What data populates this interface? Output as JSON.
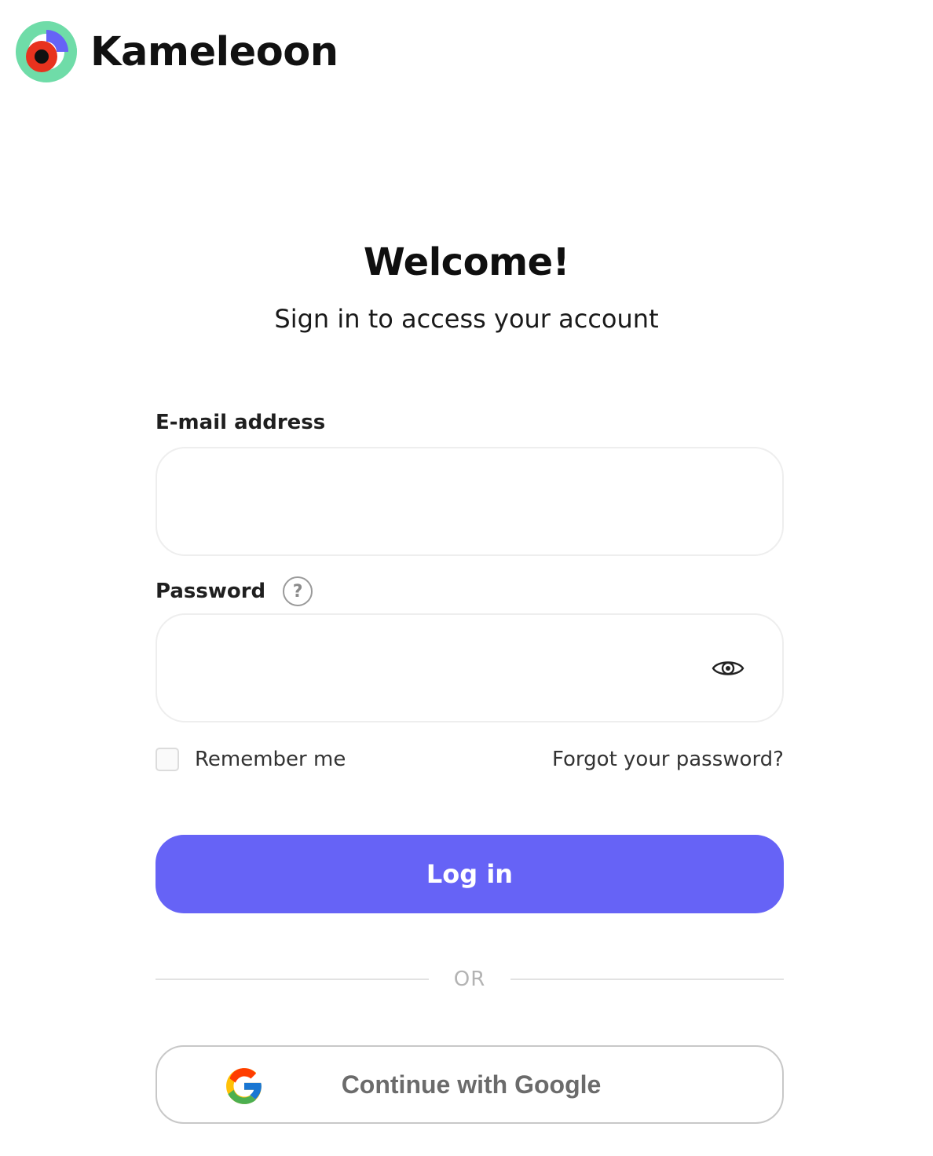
{
  "brand": {
    "name": "Kameleoon",
    "logo_icon": "kameleoon-logo-icon",
    "colors": {
      "mint": "#6fdca8",
      "purple": "#6663f6",
      "red": "#e8321e",
      "black": "#111111"
    }
  },
  "heading": {
    "title": "Welcome!",
    "subtitle": "Sign in to access your account"
  },
  "form": {
    "email": {
      "label": "E-mail address",
      "value": "",
      "placeholder": ""
    },
    "password": {
      "label": "Password",
      "value": "",
      "placeholder": "",
      "help_icon": "question-circle-icon",
      "toggle_icon": "eye-icon"
    },
    "remember_me": {
      "label": "Remember me",
      "checked": false
    },
    "forgot_password": "Forgot your password?",
    "login_button": "Log in",
    "divider_text": "OR",
    "google_button": {
      "label": "Continue with Google",
      "icon": "google-icon"
    }
  },
  "colors": {
    "primary": "#6663f6",
    "text": "#161616",
    "muted": "#b3b3b3"
  }
}
